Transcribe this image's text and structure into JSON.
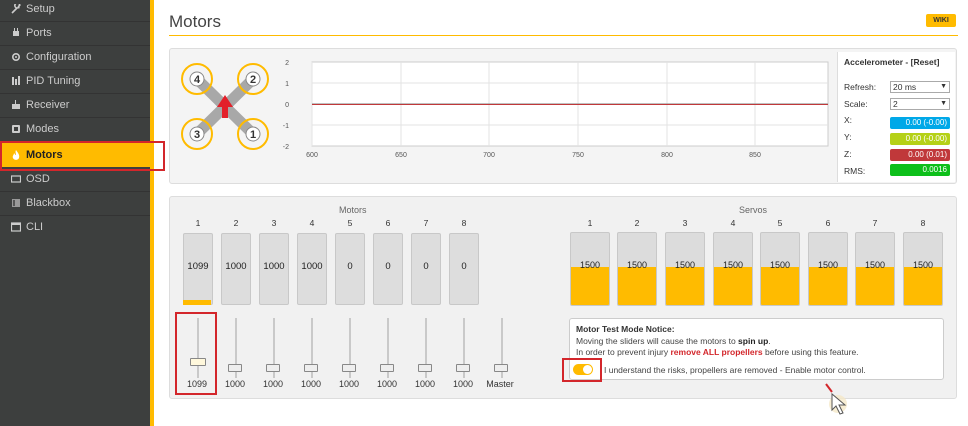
{
  "sidebar": {
    "items": [
      {
        "label": "Setup",
        "icon": "wrench-icon"
      },
      {
        "label": "Ports",
        "icon": "plug-icon"
      },
      {
        "label": "Configuration",
        "icon": "gear-icon"
      },
      {
        "label": "PID Tuning",
        "icon": "sliders-icon"
      },
      {
        "label": "Receiver",
        "icon": "receiver-icon"
      },
      {
        "label": "Modes",
        "icon": "modes-icon"
      },
      {
        "label": "Motors",
        "icon": "flame-icon",
        "active": true
      },
      {
        "label": "OSD",
        "icon": "osd-icon"
      },
      {
        "label": "Blackbox",
        "icon": "blackbox-icon"
      },
      {
        "label": "CLI",
        "icon": "cli-icon"
      }
    ]
  },
  "header": {
    "title": "Motors",
    "wiki_label": "WIKI"
  },
  "quad": {
    "motor_labels": [
      "4",
      "2",
      "3",
      "1"
    ]
  },
  "graph": {
    "y_ticks": [
      "2",
      "1",
      "0",
      "-1",
      "-2"
    ],
    "x_ticks": [
      "600",
      "650",
      "700",
      "750",
      "800",
      "850"
    ]
  },
  "accelerometer": {
    "title": "Accelerometer - [Reset]",
    "refresh_label": "Refresh:",
    "refresh_value": "20 ms",
    "scale_label": "Scale:",
    "scale_value": "2",
    "rows": [
      {
        "label": "X:",
        "value": "0.00 (-0.00)",
        "color": "#00a8e8"
      },
      {
        "label": "Y:",
        "value": "0.00 (-0.00)",
        "color": "#b5d117"
      },
      {
        "label": "Z:",
        "value": "0.00 (0.01)",
        "color": "#c0383a"
      },
      {
        "label": "RMS:",
        "value": "0.0016",
        "color": "#0dbf1a"
      }
    ]
  },
  "motors": {
    "title": "Motors",
    "columns": [
      "1",
      "2",
      "3",
      "4",
      "5",
      "6",
      "7",
      "8"
    ],
    "values": [
      "1099",
      "1000",
      "1000",
      "1000",
      "0",
      "0",
      "0",
      "0"
    ],
    "slider_values": [
      "1099",
      "1000",
      "1000",
      "1000",
      "1000",
      "1000",
      "1000",
      "1000"
    ],
    "master_label": "Master"
  },
  "servos": {
    "title": "Servos",
    "columns": [
      "1",
      "2",
      "3",
      "4",
      "5",
      "6",
      "7",
      "8"
    ],
    "values": [
      "1500",
      "1500",
      "1500",
      "1500",
      "1500",
      "1500",
      "1500",
      "1500"
    ]
  },
  "notice": {
    "title": "Motor Test Mode Notice:",
    "line1_a": "Moving the sliders will cause the motors to ",
    "line1_b": "spin up",
    "line1_c": ".",
    "line2_a": "In order to prevent injury ",
    "line2_b": "remove ALL propellers",
    "line2_c": " before using this feature.",
    "enable_label": "I understand the risks, propellers are removed - Enable motor control."
  },
  "colors": {
    "accent": "#ffbb00",
    "highlight": "#d3262b",
    "sidebar": "#3d3f3e"
  }
}
